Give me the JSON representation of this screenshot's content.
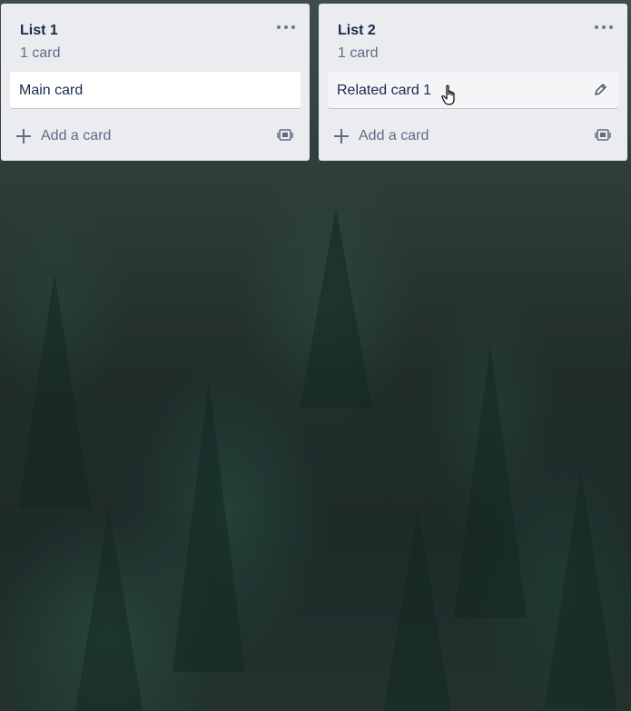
{
  "lists": [
    {
      "title": "List 1",
      "count": "1 card",
      "cards": [
        "Main card"
      ],
      "add_card_label": "Add a card"
    },
    {
      "title": "List 2",
      "count": "1 card",
      "cards": [
        "Related card 1"
      ],
      "add_card_label": "Add a card"
    }
  ],
  "icons": {
    "list_menu": "more-horizontal-icon",
    "edit": "pencil-icon",
    "add": "plus-icon",
    "template": "card-template-icon",
    "cursor": "hand-pointer-cursor"
  },
  "colors": {
    "list_bg": "#ebecf0",
    "card_bg": "#ffffff",
    "text": "#172b4d",
    "muted_text": "#5e6c84"
  }
}
